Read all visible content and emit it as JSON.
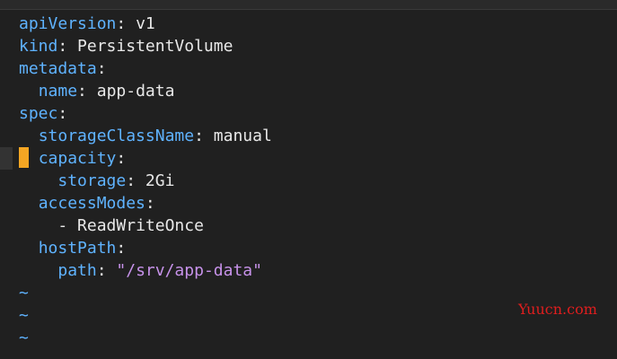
{
  "editor": {
    "lines": [
      {
        "key": "apiVersion",
        "value": "v1"
      },
      {
        "key": "kind",
        "value": "PersistentVolume"
      },
      {
        "key": "metadata",
        "value": ""
      },
      {
        "key": "name",
        "value": "app-data"
      },
      {
        "key": "spec",
        "value": ""
      },
      {
        "key": "storageClassName",
        "value": "manual"
      },
      {
        "key": "capacity",
        "value": ""
      },
      {
        "key": "storage",
        "value": "2Gi"
      },
      {
        "key": "accessModes",
        "value": ""
      },
      {
        "dash": "-",
        "value": "ReadWriteOnce"
      },
      {
        "key": "hostPath",
        "value": ""
      },
      {
        "key": "path",
        "value": "\"/srv/app-data\""
      }
    ],
    "tilde_lines": [
      "~",
      "~",
      "~"
    ],
    "cursor_line": 7
  },
  "watermark": {
    "text": "Yuucn.com"
  },
  "colors": {
    "key": "#5fb3ff",
    "string": "#c792ea",
    "cursor": "#f5a623",
    "background": "#202020"
  }
}
